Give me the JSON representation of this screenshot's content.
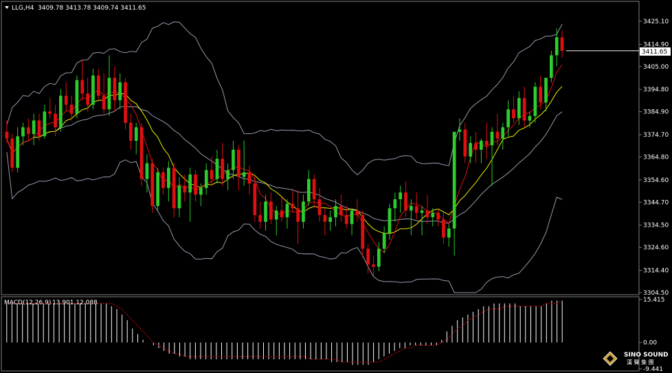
{
  "header": {
    "symbol": "LLG,H4",
    "ohlc": "3409.78 3413.78 3409.74 3411.65"
  },
  "macd_header": {
    "label": "MACD(12,26,9)",
    "values": "13.901 12.088"
  },
  "logo": {
    "name": "SINO SOUND",
    "sub": "漢 聲 集 團"
  },
  "colors": {
    "background": "#000000",
    "bull": "#2ecc2e",
    "bear": "#e01010",
    "bands": "#9a9ab0",
    "ma_fast": "#e01010",
    "ma_slow": "#f0f000",
    "histogram": "#ffffff",
    "signal": "#e01010",
    "grid": "#808080"
  },
  "chart_data": [
    {
      "type": "candlestick",
      "title": "LLG,H4",
      "current_price": "3411.65",
      "y_tick_labels": [
        "3425.10",
        "3414.90",
        "3405.00",
        "3394.80",
        "3384.90",
        "3374.70",
        "3364.80",
        "3354.60",
        "3344.70",
        "3334.50",
        "3324.60",
        "3314.40",
        "3304.50"
      ],
      "ylim": [
        3304.5,
        3425.1
      ],
      "overlays": [
        "Bollinger Bands",
        "Moving Average (fast, red)",
        "Moving Average (slow, yellow)"
      ],
      "candles": [
        [
          3376,
          3381,
          3371,
          3373
        ],
        [
          3373,
          3375,
          3358,
          3360
        ],
        [
          3360,
          3378,
          3358,
          3374
        ],
        [
          3374,
          3380,
          3370,
          3378
        ],
        [
          3378,
          3382,
          3372,
          3375
        ],
        [
          3375,
          3384,
          3370,
          3381
        ],
        [
          3381,
          3384,
          3372,
          3374
        ],
        [
          3374,
          3388,
          3373,
          3385
        ],
        [
          3385,
          3391,
          3382,
          3384
        ],
        [
          3384,
          3388,
          3374,
          3378
        ],
        [
          3378,
          3395,
          3376,
          3392
        ],
        [
          3392,
          3398,
          3385,
          3388
        ],
        [
          3388,
          3392,
          3381,
          3384
        ],
        [
          3384,
          3401,
          3382,
          3399
        ],
        [
          3399,
          3408,
          3390,
          3393
        ],
        [
          3393,
          3400,
          3385,
          3388
        ],
        [
          3388,
          3404,
          3386,
          3401
        ],
        [
          3401,
          3404,
          3390,
          3392
        ],
        [
          3392,
          3402,
          3384,
          3386
        ],
        [
          3386,
          3410,
          3383,
          3400
        ],
        [
          3400,
          3405,
          3385,
          3390
        ],
        [
          3390,
          3402,
          3386,
          3398
        ],
        [
          3398,
          3400,
          3377,
          3380
        ],
        [
          3380,
          3384,
          3368,
          3372
        ],
        [
          3372,
          3380,
          3366,
          3378
        ],
        [
          3378,
          3380,
          3352,
          3355
        ],
        [
          3355,
          3366,
          3349,
          3362
        ],
        [
          3362,
          3364,
          3340,
          3343
        ],
        [
          3343,
          3360,
          3341,
          3358
        ],
        [
          3358,
          3360,
          3348,
          3351
        ],
        [
          3351,
          3363,
          3345,
          3360
        ],
        [
          3360,
          3362,
          3338,
          3342
        ],
        [
          3342,
          3356,
          3338,
          3352
        ],
        [
          3352,
          3357,
          3345,
          3349
        ],
        [
          3349,
          3360,
          3336,
          3357
        ],
        [
          3357,
          3359,
          3345,
          3348
        ],
        [
          3348,
          3353,
          3343,
          3351
        ],
        [
          3351,
          3362,
          3348,
          3359
        ],
        [
          3359,
          3365,
          3352,
          3355
        ],
        [
          3355,
          3368,
          3353,
          3364
        ],
        [
          3364,
          3371,
          3352,
          3355
        ],
        [
          3355,
          3362,
          3350,
          3359
        ],
        [
          3359,
          3372,
          3355,
          3368
        ],
        [
          3368,
          3370,
          3350,
          3356
        ],
        [
          3356,
          3372,
          3352,
          3358
        ],
        [
          3358,
          3361,
          3348,
          3353
        ],
        [
          3353,
          3356,
          3336,
          3339
        ],
        [
          3339,
          3345,
          3333,
          3336
        ],
        [
          3336,
          3348,
          3332,
          3345
        ],
        [
          3345,
          3349,
          3335,
          3337
        ],
        [
          3337,
          3343,
          3330,
          3341
        ],
        [
          3341,
          3347,
          3336,
          3338
        ],
        [
          3338,
          3346,
          3333,
          3344
        ],
        [
          3344,
          3350,
          3340,
          3342
        ],
        [
          3342,
          3350,
          3326,
          3336
        ],
        [
          3336,
          3348,
          3333,
          3345
        ],
        [
          3345,
          3359,
          3343,
          3355
        ],
        [
          3355,
          3357,
          3342,
          3346
        ],
        [
          3346,
          3351,
          3336,
          3339
        ],
        [
          3339,
          3342,
          3330,
          3336
        ],
        [
          3336,
          3341,
          3332,
          3338
        ],
        [
          3338,
          3346,
          3334,
          3343
        ],
        [
          3343,
          3348,
          3336,
          3339
        ],
        [
          3339,
          3343,
          3333,
          3335
        ],
        [
          3335,
          3342,
          3330,
          3341
        ],
        [
          3341,
          3346,
          3336,
          3339
        ],
        [
          3339,
          3341,
          3320,
          3324
        ],
        [
          3324,
          3326,
          3313,
          3317
        ],
        [
          3317,
          3321,
          3312,
          3316
        ],
        [
          3316,
          3327,
          3314,
          3324
        ],
        [
          3324,
          3334,
          3322,
          3331
        ],
        [
          3331,
          3344,
          3328,
          3342
        ],
        [
          3342,
          3349,
          3336,
          3346
        ],
        [
          3346,
          3352,
          3340,
          3349
        ],
        [
          3349,
          3354,
          3338,
          3341
        ],
        [
          3341,
          3346,
          3330,
          3343
        ],
        [
          3343,
          3349,
          3337,
          3340
        ],
        [
          3340,
          3343,
          3330,
          3341
        ],
        [
          3341,
          3348,
          3335,
          3338
        ],
        [
          3338,
          3342,
          3334,
          3340
        ],
        [
          3340,
          3342,
          3334,
          3337
        ],
        [
          3337,
          3340,
          3326,
          3329
        ],
        [
          3329,
          3335,
          3325,
          3333
        ],
        [
          3333,
          3340,
          3321,
          3376
        ],
        [
          3376,
          3382,
          3372,
          3377
        ],
        [
          3377,
          3380,
          3362,
          3365
        ],
        [
          3365,
          3374,
          3362,
          3371
        ],
        [
          3371,
          3376,
          3362,
          3368
        ],
        [
          3368,
          3373,
          3362,
          3372
        ],
        [
          3372,
          3380,
          3364,
          3370
        ],
        [
          3370,
          3378,
          3352,
          3376
        ],
        [
          3376,
          3384,
          3370,
          3373
        ],
        [
          3373,
          3380,
          3368,
          3378
        ],
        [
          3378,
          3390,
          3374,
          3386
        ],
        [
          3386,
          3392,
          3380,
          3382
        ],
        [
          3382,
          3394,
          3379,
          3391
        ],
        [
          3391,
          3396,
          3378,
          3381
        ],
        [
          3381,
          3385,
          3378,
          3383
        ],
        [
          3383,
          3398,
          3380,
          3396
        ],
        [
          3396,
          3401,
          3386,
          3389
        ],
        [
          3389,
          3394,
          3385,
          3400
        ],
        [
          3400,
          3412,
          3398,
          3410
        ],
        [
          3410,
          3422,
          3405,
          3418
        ],
        [
          3418,
          3421,
          3409,
          3412
        ]
      ]
    },
    {
      "type": "bar",
      "title": "MACD(12,26,9)",
      "y_tick_labels": [
        "15.415",
        "0.00",
        "-9.441"
      ],
      "ylim": [
        -9.441,
        15.415
      ],
      "histogram_values": [
        14,
        14,
        14,
        14,
        14,
        14,
        14,
        14,
        14,
        14,
        14,
        14,
        14,
        14,
        14,
        14,
        14,
        14,
        14,
        14,
        13,
        12,
        10,
        8,
        5,
        3,
        1,
        0,
        -1,
        -2,
        -3,
        -4,
        -4,
        -5,
        -5,
        -6,
        -6,
        -6,
        -6,
        -6,
        -6,
        -6,
        -6,
        -6,
        -6,
        -6,
        -6,
        -6,
        -6,
        -6,
        -6,
        -6,
        -6,
        -6,
        -6,
        -6,
        -6,
        -6,
        -6,
        -6,
        -6,
        -6,
        -7,
        -7,
        -7,
        -7,
        -8,
        -8,
        -8,
        -8,
        -7,
        -6,
        -5,
        -4,
        -3,
        -2,
        -2,
        -1,
        -1,
        -1,
        -1,
        -1,
        -1,
        1,
        4,
        6,
        8,
        9,
        10,
        11,
        12,
        13,
        13,
        14,
        14,
        14,
        14,
        14,
        13,
        13,
        13,
        13,
        13,
        14,
        15,
        15,
        15
      ],
      "signal_values": [
        14,
        14,
        14,
        14,
        14,
        14,
        14,
        14,
        14,
        14,
        14,
        14,
        14,
        14,
        14,
        14,
        14,
        14,
        14,
        14,
        14,
        13,
        12,
        10,
        8,
        6,
        4,
        2,
        0,
        -1,
        -2,
        -3,
        -4,
        -4,
        -5,
        -5,
        -5,
        -5,
        -5,
        -5,
        -5,
        -5,
        -5,
        -5,
        -5,
        -5,
        -5,
        -5,
        -5,
        -5,
        -5,
        -5,
        -5,
        -5,
        -5,
        -5,
        -5,
        -5,
        -6,
        -6,
        -6,
        -6,
        -6,
        -6,
        -7,
        -7,
        -7,
        -7,
        -7,
        -7,
        -7,
        -7,
        -6,
        -5,
        -4,
        -3,
        -2,
        -2,
        -1,
        -1,
        -1,
        -1,
        -1,
        0,
        1,
        3,
        5,
        6,
        8,
        9,
        10,
        11,
        12,
        12,
        12,
        13,
        13,
        13,
        13,
        13,
        13,
        13,
        13,
        14,
        14,
        14,
        15
      ]
    }
  ]
}
